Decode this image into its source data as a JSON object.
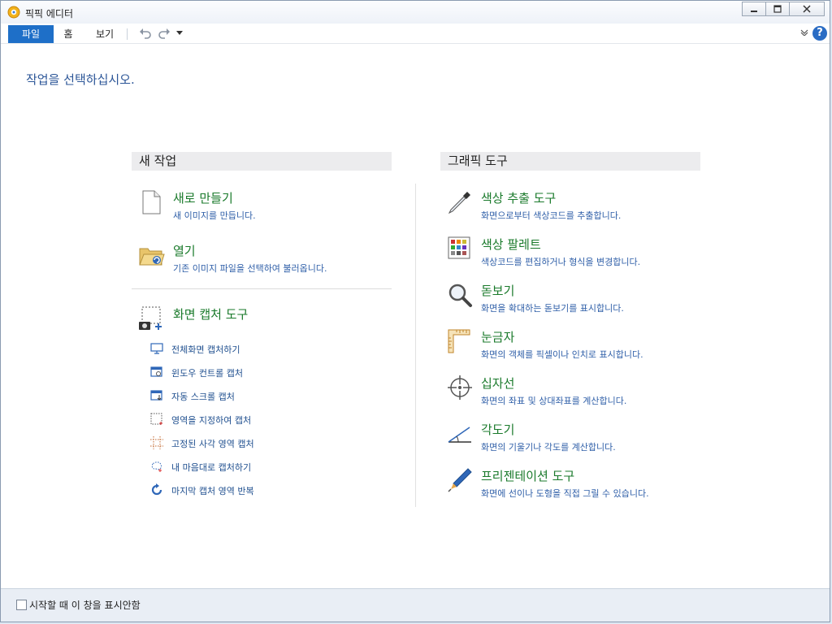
{
  "window": {
    "title": "픽픽 에디터"
  },
  "ribbon": {
    "tabs": [
      "파일",
      "홈",
      "보기"
    ]
  },
  "prompt": "작업을 선택하십시오.",
  "new_work": {
    "header": "새 작업",
    "items": [
      {
        "title": "새로 만들기",
        "desc": "새 이미지를 만듭니다.",
        "icon": "new-document-icon"
      },
      {
        "title": "열기",
        "desc": "기존 이미지 파일을 선택하여 불러옵니다.",
        "icon": "open-folder-icon"
      }
    ],
    "capture": {
      "title": "화면 캡처 도구",
      "icon": "camera-capture-icon",
      "options": [
        {
          "label": "전체화면 캡처하기",
          "icon": "monitor-icon"
        },
        {
          "label": "윈도우 컨트롤 캡처",
          "icon": "window-control-icon"
        },
        {
          "label": "자동 스크롤 캡처",
          "icon": "scroll-capture-icon"
        },
        {
          "label": "영역을 지정하여 캡처",
          "icon": "region-select-icon"
        },
        {
          "label": "고정된 사각 영역 캡처",
          "icon": "fixed-region-icon"
        },
        {
          "label": "내 마음대로 캡처하기",
          "icon": "freehand-icon"
        },
        {
          "label": "마지막 캡처 영역 반복",
          "icon": "repeat-icon"
        }
      ]
    }
  },
  "graphic_tools": {
    "header": "그래픽 도구",
    "items": [
      {
        "title": "색상 추출 도구",
        "desc": "화면으로부터 색상코드를 추출합니다.",
        "icon": "eyedropper-icon"
      },
      {
        "title": "색상 팔레트",
        "desc": "색상코드를 편집하거나 형식을 변경합니다.",
        "icon": "palette-icon"
      },
      {
        "title": "돋보기",
        "desc": "화면을 확대하는 돋보기를 표시합니다.",
        "icon": "magnifier-icon"
      },
      {
        "title": "눈금자",
        "desc": "화면의 객체를 픽셀이나 인치로 표시합니다.",
        "icon": "ruler-icon"
      },
      {
        "title": "십자선",
        "desc": "화면의 좌표 및 상대좌표를 계산합니다.",
        "icon": "crosshair-icon"
      },
      {
        "title": "각도기",
        "desc": "화면의 기울기나 각도를 계산합니다.",
        "icon": "protractor-icon"
      },
      {
        "title": "프리젠테이션 도구",
        "desc": "화면에 선이나 도형을 직접 그릴 수 있습니다.",
        "icon": "pen-icon"
      }
    ]
  },
  "footer": {
    "checkbox_label": "시작할 때 이 창을 표시안함",
    "checked": false
  },
  "colors": {
    "accent": "#1e6fc8",
    "title_green": "#1a7a2b",
    "desc_blue": "#2f5fa8"
  }
}
